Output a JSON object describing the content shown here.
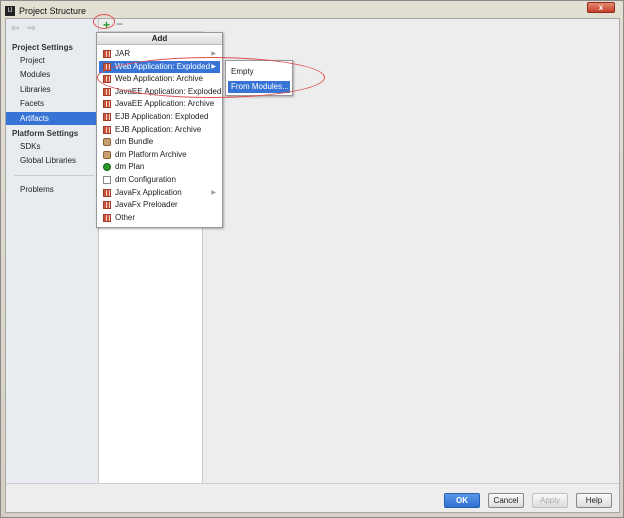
{
  "window": {
    "title": "Project Structure",
    "close_label": "x"
  },
  "sidebar": {
    "back": "⇦",
    "forward": "⇨",
    "project_settings": "Project Settings",
    "project_items": [
      "Project",
      "Modules",
      "Libraries",
      "Facets",
      "Artifacts"
    ],
    "platform_settings": "Platform Settings",
    "platform_items": [
      "SDKs",
      "Global Libraries"
    ],
    "problems": "Problems",
    "selected": "Artifacts"
  },
  "toolbar": {
    "add": "+",
    "remove": "−"
  },
  "add_menu": {
    "header": "Add",
    "items": [
      {
        "label": "JAR",
        "icon": "jar",
        "submenu": true
      },
      {
        "label": "Web Application: Exploded",
        "icon": "web",
        "submenu": true,
        "selected": true
      },
      {
        "label": "Web Application: Archive",
        "icon": "web"
      },
      {
        "label": "JavaEE Application: Exploded",
        "icon": "jar"
      },
      {
        "label": "JavaEE Application: Archive",
        "icon": "jar"
      },
      {
        "label": "EJB Application: Exploded",
        "icon": "jar"
      },
      {
        "label": "EJB Application: Archive",
        "icon": "jar"
      },
      {
        "label": "dm Bundle",
        "icon": "bundle"
      },
      {
        "label": "dm Platform Archive",
        "icon": "bundle"
      },
      {
        "label": "dm Plan",
        "icon": "plan"
      },
      {
        "label": "dm Configuration",
        "icon": "document"
      },
      {
        "label": "JavaFx Application",
        "icon": "jar",
        "submenu": true
      },
      {
        "label": "JavaFx Preloader",
        "icon": "jar"
      },
      {
        "label": "Other",
        "icon": "jar"
      }
    ]
  },
  "submenu": {
    "items": [
      "Empty",
      "From Modules..."
    ],
    "selected": "From Modules..."
  },
  "buttons": {
    "ok": "OK",
    "cancel": "Cancel",
    "apply": "Apply",
    "help": "Help"
  },
  "colors": {
    "selection": "#3874d6",
    "annotation": "#e05050"
  }
}
